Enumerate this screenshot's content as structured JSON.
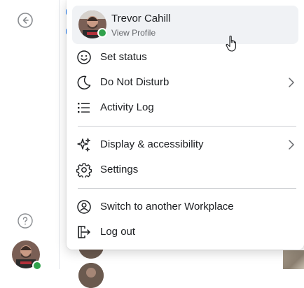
{
  "profile": {
    "name": "Trevor Cahill",
    "subtitle": "View Profile",
    "status_color": "#31a24c"
  },
  "menu": {
    "group1": [
      {
        "label": "Set status",
        "icon": "smiley-icon",
        "has_submenu": false
      },
      {
        "label": "Do Not Disturb",
        "icon": "moon-icon",
        "has_submenu": true
      },
      {
        "label": "Activity Log",
        "icon": "list-icon",
        "has_submenu": false
      }
    ],
    "group2": [
      {
        "label": "Display & accessibility",
        "icon": "sparkle-icon",
        "has_submenu": true
      },
      {
        "label": "Settings",
        "icon": "gear-icon",
        "has_submenu": false
      }
    ],
    "group3": [
      {
        "label": "Switch to another Workplace",
        "icon": "switch-account-icon",
        "has_submenu": false
      },
      {
        "label": "Log out",
        "icon": "logout-icon",
        "has_submenu": false
      }
    ]
  },
  "sidebar": {
    "back_icon": "back-arrow-icon",
    "help_icon": "help-icon"
  },
  "colors": {
    "accent": "#1877f2",
    "card_bg": "#f0f2f5",
    "text": "#1c1e21",
    "subtext": "#65676b"
  }
}
